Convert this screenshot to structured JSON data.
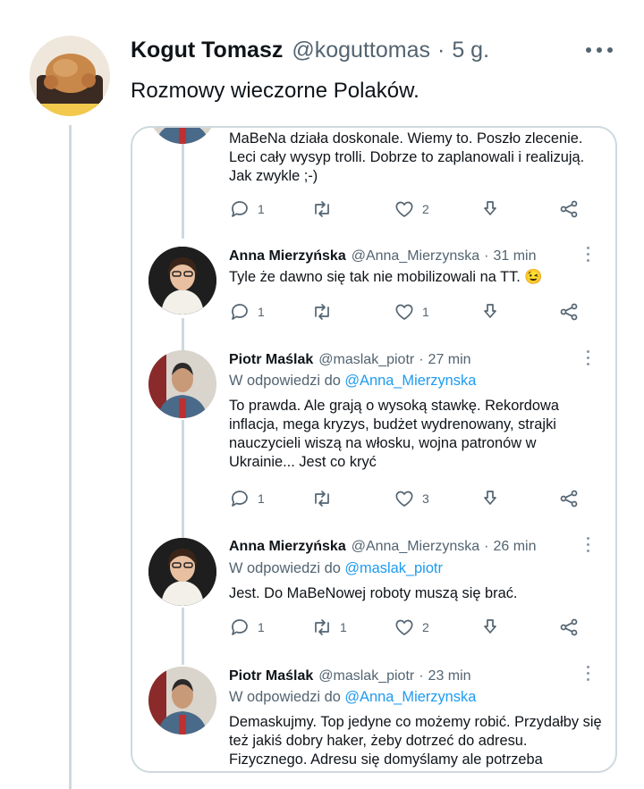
{
  "main_tweet": {
    "name": "Kogut Tomasz",
    "handle": "@koguttomas",
    "separator": "·",
    "time": "5 g.",
    "text": "Rozmowy wieczorne Polaków."
  },
  "quoted": {
    "partial_text": "MaBeNa działa doskonale. Wiemy to. Poszło zlecenie. Leci cały wysyp trolli. Dobrze to zaplanowali i realizują. Jak zwykle ;-)",
    "partial_actions": {
      "replies": "1",
      "retweets": "",
      "likes": "2"
    },
    "replies": [
      {
        "name": "Anna Mierzyńska",
        "handle": "@Anna_Mierzynska",
        "time": "31 min",
        "reply_prefix": "",
        "reply_to": "",
        "text": "Tyle że dawno się tak nie mobilizowali na TT. 😉",
        "actions": {
          "replies": "1",
          "retweets": "",
          "likes": "1"
        }
      },
      {
        "name": "Piotr Maślak",
        "handle": "@maslak_piotr",
        "time": "27 min",
        "reply_prefix": "W odpowiedzi do",
        "reply_to": "@Anna_Mierzynska",
        "text": "To prawda. Ale grają o wysoką stawkę. Rekordowa inflacja, mega kryzys, budżet wydrenowany, strajki nauczycieli wiszą na włosku, wojna patronów w Ukrainie... Jest co kryć",
        "actions": {
          "replies": "1",
          "retweets": "",
          "likes": "3"
        }
      },
      {
        "name": "Anna Mierzyńska",
        "handle": "@Anna_Mierzynska",
        "time": "26 min",
        "reply_prefix": "W odpowiedzi do",
        "reply_to": "@maslak_piotr",
        "text": "Jest. Do MaBeNowej roboty muszą się brać.",
        "actions": {
          "replies": "1",
          "retweets": "1",
          "likes": "2"
        }
      },
      {
        "name": "Piotr Maślak",
        "handle": "@maslak_piotr",
        "time": "23 min",
        "reply_prefix": "W odpowiedzi do",
        "reply_to": "@Anna_Mierzynska",
        "text": "Demaskujmy. Top jedyne co możemy robić. Przydałby się też jakiś dobry haker, żeby dotrzeć do adresu. Fizycznego. Adresu się domyślamy ale potrzeba",
        "actions": {
          "replies": "",
          "retweets": "",
          "likes": ""
        }
      }
    ]
  },
  "colors": {
    "text": "#0f1419",
    "secondary": "#536471",
    "link": "#1d9bf0",
    "border": "#cfd9de"
  },
  "icons": [
    "more-icon",
    "reply-icon",
    "retweet-icon",
    "like-icon",
    "bookmark-icon",
    "share-icon",
    "vertical-dots-icon"
  ]
}
